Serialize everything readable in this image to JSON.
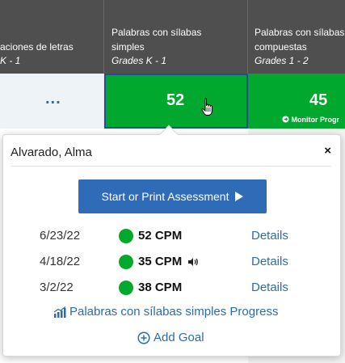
{
  "columns": [
    {
      "title": "aciones de letras",
      "grades": "K - 1"
    },
    {
      "title_line1": "Palabras con sílabas",
      "title_line2": "simples",
      "grades": "Grades K - 1"
    },
    {
      "title_line1": "Palabras con sílabas",
      "title_line2": "compuestas",
      "grades": "Grades 1 - 2"
    }
  ],
  "cells": [
    {
      "value": "..."
    },
    {
      "value": "52"
    },
    {
      "value": "45",
      "action": "Monitor Progr"
    }
  ],
  "popover": {
    "title": "Alvarado, Alma",
    "close": "×",
    "start_button": "Start or Print Assessment",
    "results": [
      {
        "date": "6/23/22",
        "score": "52 CPM",
        "audio": false,
        "link": "Details"
      },
      {
        "date": "4/18/22",
        "score": "35 CPM",
        "audio": true,
        "link": "Details"
      },
      {
        "date": "3/2/22",
        "score": "38 CPM",
        "audio": false,
        "link": "Details"
      }
    ],
    "progress_link": "Palabras con sílabas simples Progress",
    "goal_link": "Add Goal"
  },
  "colors": {
    "header_bg": "#4f4f4f",
    "score_green": "#00a82d",
    "link_blue": "#2b6cb0",
    "button_blue": "#2f6bb7",
    "selected_border": "#1f4f8f"
  },
  "icons": [
    "pointer-hand-icon",
    "play-arrow-icon",
    "speaker-icon",
    "bar-chart-icon",
    "plus-circle-icon",
    "arrow-circle-icon",
    "close-icon"
  ]
}
